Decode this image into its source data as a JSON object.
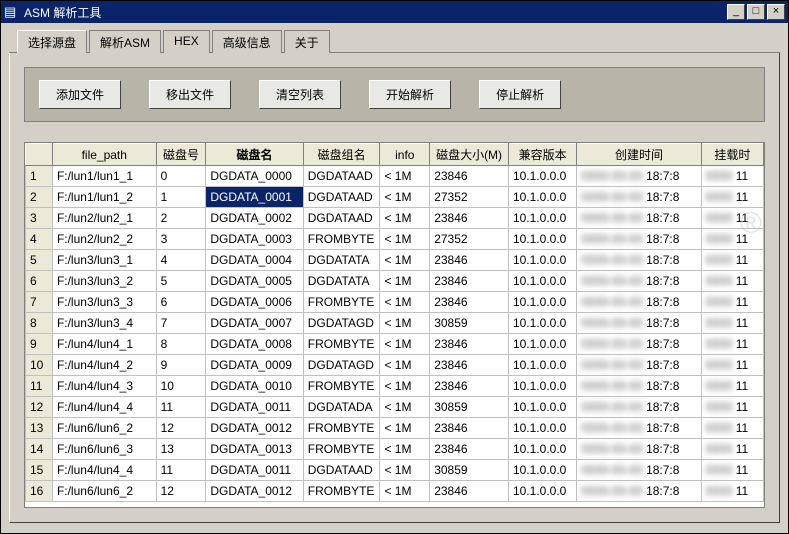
{
  "window": {
    "title": "ASM 解析工具"
  },
  "tabs": [
    "选择源盘",
    "解析ASM",
    "HEX",
    "高级信息",
    "关于"
  ],
  "active_tab": 0,
  "toolbar": {
    "add": "添加文件",
    "remove": "移出文件",
    "clear": "清空列表",
    "start": "开始解析",
    "stop": "停止解析"
  },
  "columns": {
    "corner": "",
    "file_path": "file_path",
    "disk_no": "磁盘号",
    "disk_name": "磁盘名",
    "disk_group": "磁盘组名",
    "info": "info",
    "disk_size": "磁盘大小(M)",
    "compat": "兼容版本",
    "ctime": "创建时间",
    "mtime": "挂载时"
  },
  "sort_col": "disk_name",
  "selected_row": 1,
  "rows": [
    {
      "file_path": "F:/lun1/lun1_1",
      "disk_no": "0",
      "disk_name": "DGDATA_0000",
      "disk_group": "DGDATAAD",
      "info": "<  1M",
      "disk_size": "23846",
      "compat": "10.1.0.0.0",
      "ctime": "18:7:8",
      "mtime": "11"
    },
    {
      "file_path": "F:/lun1/lun1_2",
      "disk_no": "1",
      "disk_name": "DGDATA_0001",
      "disk_group": "DGDATAAD",
      "info": "<  1M",
      "disk_size": "27352",
      "compat": "10.1.0.0.0",
      "ctime": "18:7:8",
      "mtime": "11"
    },
    {
      "file_path": "F:/lun2/lun2_1",
      "disk_no": "2",
      "disk_name": "DGDATA_0002",
      "disk_group": "DGDATAAD",
      "info": "<  1M",
      "disk_size": "23846",
      "compat": "10.1.0.0.0",
      "ctime": "18:7:8",
      "mtime": "11"
    },
    {
      "file_path": "F:/lun2/lun2_2",
      "disk_no": "3",
      "disk_name": "DGDATA_0003",
      "disk_group": "FROMBYTE",
      "info": "<  1M",
      "disk_size": "27352",
      "compat": "10.1.0.0.0",
      "ctime": "18:7:8",
      "mtime": "11"
    },
    {
      "file_path": "F:/lun3/lun3_1",
      "disk_no": "4",
      "disk_name": "DGDATA_0004",
      "disk_group": "DGDATATA",
      "info": "<  1M",
      "disk_size": "23846",
      "compat": "10.1.0.0.0",
      "ctime": "18:7:8",
      "mtime": "11"
    },
    {
      "file_path": "F:/lun3/lun3_2",
      "disk_no": "5",
      "disk_name": "DGDATA_0005",
      "disk_group": "DGDATATA",
      "info": "<  1M",
      "disk_size": "23846",
      "compat": "10.1.0.0.0",
      "ctime": "18:7:8",
      "mtime": "11"
    },
    {
      "file_path": "F:/lun3/lun3_3",
      "disk_no": "6",
      "disk_name": "DGDATA_0006",
      "disk_group": "FROMBYTE",
      "info": "<  1M",
      "disk_size": "23846",
      "compat": "10.1.0.0.0",
      "ctime": "18:7:8",
      "mtime": "11"
    },
    {
      "file_path": "F:/lun3/lun3_4",
      "disk_no": "7",
      "disk_name": "DGDATA_0007",
      "disk_group": "DGDATAGD",
      "info": "<  1M",
      "disk_size": "30859",
      "compat": "10.1.0.0.0",
      "ctime": "18:7:8",
      "mtime": "11"
    },
    {
      "file_path": "F:/lun4/lun4_1",
      "disk_no": "8",
      "disk_name": "DGDATA_0008",
      "disk_group": "FROMBYTE",
      "info": "<  1M",
      "disk_size": "23846",
      "compat": "10.1.0.0.0",
      "ctime": "18:7:8",
      "mtime": "11"
    },
    {
      "file_path": "F:/lun4/lun4_2",
      "disk_no": "9",
      "disk_name": "DGDATA_0009",
      "disk_group": "DGDATAGD",
      "info": "<  1M",
      "disk_size": "23846",
      "compat": "10.1.0.0.0",
      "ctime": "18:7:8",
      "mtime": "11"
    },
    {
      "file_path": "F:/lun4/lun4_3",
      "disk_no": "10",
      "disk_name": "DGDATA_0010",
      "disk_group": "FROMBYTE",
      "info": "<  1M",
      "disk_size": "23846",
      "compat": "10.1.0.0.0",
      "ctime": "18:7:8",
      "mtime": "11"
    },
    {
      "file_path": "F:/lun4/lun4_4",
      "disk_no": "11",
      "disk_name": "DGDATA_0011",
      "disk_group": "DGDATADA",
      "info": "<  1M",
      "disk_size": "30859",
      "compat": "10.1.0.0.0",
      "ctime": "18:7:8",
      "mtime": "11"
    },
    {
      "file_path": "F:/lun6/lun6_2",
      "disk_no": "12",
      "disk_name": "DGDATA_0012",
      "disk_group": "FROMBYTE",
      "info": "<  1M",
      "disk_size": "23846",
      "compat": "10.1.0.0.0",
      "ctime": "18:7:8",
      "mtime": "11"
    },
    {
      "file_path": "F:/lun6/lun6_3",
      "disk_no": "13",
      "disk_name": "DGDATA_0013",
      "disk_group": "FROMBYTE",
      "info": "<  1M",
      "disk_size": "23846",
      "compat": "10.1.0.0.0",
      "ctime": "18:7:8",
      "mtime": "11"
    },
    {
      "file_path": "F:/lun4/lun4_4",
      "disk_no": "11",
      "disk_name": "DGDATA_0011",
      "disk_group": "DGDATAAD",
      "info": "<  1M",
      "disk_size": "30859",
      "compat": "10.1.0.0.0",
      "ctime": "18:7:8",
      "mtime": "11"
    },
    {
      "file_path": "F:/lun6/lun6_2",
      "disk_no": "12",
      "disk_name": "DGDATA_0012",
      "disk_group": "FROMBYTE",
      "info": "<  1M",
      "disk_size": "23846",
      "compat": "10.1.0.0.0",
      "ctime": "18:7:8",
      "mtime": "11"
    }
  ]
}
